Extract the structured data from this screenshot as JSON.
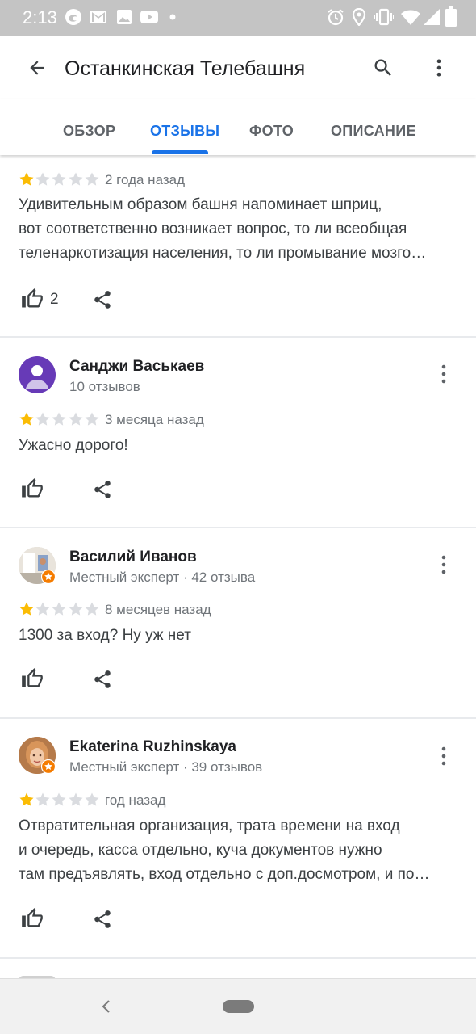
{
  "status_bar": {
    "time": "2:13",
    "left_icons": [
      "edge-icon",
      "gmail-icon",
      "photo-icon",
      "youtube-icon",
      "dot-icon"
    ],
    "right_icons": [
      "alarm-icon",
      "location-icon",
      "vibrate-icon",
      "wifi-icon",
      "signal-icon",
      "battery-icon"
    ]
  },
  "app_bar": {
    "title": "Останкинская Телебашня",
    "back_icon": "arrow-back-icon",
    "search_icon": "search-icon",
    "menu_icon": "more-vert-icon"
  },
  "tabs": [
    {
      "label": "ОБЗОР",
      "active": false
    },
    {
      "label": "ОТЗЫВЫ",
      "active": true
    },
    {
      "label": "ФОТО",
      "active": false
    },
    {
      "label": "ОПИСАНИЕ",
      "active": false
    }
  ],
  "colors": {
    "accent": "#1a73e8",
    "star_filled": "#fbbc04",
    "star_empty": "#dadce0",
    "avatar_purple": "#673ab7",
    "expert_badge": "#f57c00"
  },
  "reviews": [
    {
      "author": "",
      "meta": "",
      "rating": 1,
      "max_rating": 5,
      "when": "2 года назад",
      "text_lines": [
        "Удивительным образом башня напоминает шприц,",
        "вот соответственно возникает вопрос, то ли всеобщая",
        "теленаркотизация населения, то ли промывание мозго…"
      ],
      "likes": "2"
    },
    {
      "author": "Санджи Васькаев",
      "meta": "10 отзывов",
      "rating": 1,
      "max_rating": 5,
      "when": "3 месяца назад",
      "text_lines": [
        "Ужасно дорого!"
      ],
      "likes": ""
    },
    {
      "author": "Василий Иванов",
      "meta": "Местный эксперт · 42 отзыва",
      "rating": 1,
      "max_rating": 5,
      "when": "8 месяцев назад",
      "text_lines": [
        "1300 за вход? Ну уж нет"
      ],
      "likes": ""
    },
    {
      "author": "Ekaterina Ruzhinskaya",
      "meta": "Местный эксперт · 39 отзывов",
      "rating": 1,
      "max_rating": 5,
      "when": "год назад",
      "text_lines": [
        "Отвратительная организация, трата времени на вход",
        "и очередь, касса отдельно, куча документов нужно",
        "там предъявлять, вход отдельно с доп.досмотром, и по…"
      ],
      "likes": ""
    }
  ],
  "nav_bar": {
    "back_icon": "nav-back-icon",
    "home_icon": "nav-home-pill-icon"
  }
}
